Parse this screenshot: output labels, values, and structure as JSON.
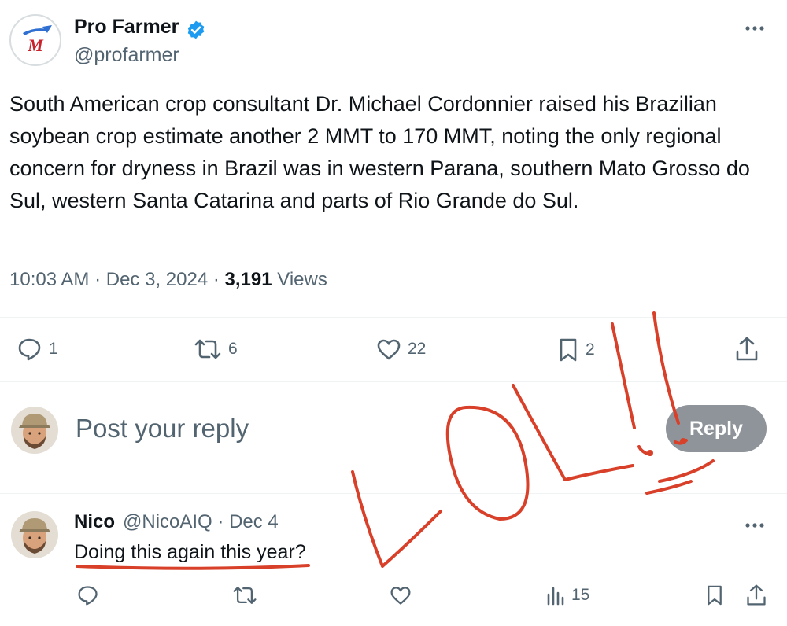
{
  "post": {
    "author_name": "Pro Farmer",
    "author_handle": "@profarmer",
    "logo_text": "M",
    "text": "South American crop consultant Dr. Michael Cordonnier raised his Brazilian soybean crop estimate another 2 MMT to 170 MMT, noting the only regional concern for dryness in Brazil was in western Parana, southern Mato Grosso do Sul, western Santa Catarina and parts of Rio Grande do Sul.",
    "time": "10:03 AM",
    "date": "Dec 3, 2024",
    "views_count": "3,191",
    "views_label": "Views",
    "replies": "1",
    "reposts": "6",
    "likes": "22",
    "bookmarks": "2"
  },
  "composer": {
    "placeholder": "Post your reply",
    "reply_button": "Reply"
  },
  "reply": {
    "name": "Nico",
    "handle": "@NicoAIQ",
    "date": "Dec 4",
    "text": "Doing this again this year?",
    "views": "15"
  },
  "annotation": {
    "scrawl": "LOL!!",
    "color": "#d8402a"
  },
  "colors": {
    "verified": "#1d9bf0",
    "muted": "#536471",
    "reply_button": "#8e9499"
  },
  "icons": {
    "more": "more-horizontal-icon",
    "verified": "verified-badge-icon",
    "reply": "speech-bubble-icon",
    "repost": "repost-arrows-icon",
    "like": "heart-icon",
    "bookmark": "bookmark-icon",
    "share": "share-upload-icon",
    "views": "bar-chart-icon"
  }
}
